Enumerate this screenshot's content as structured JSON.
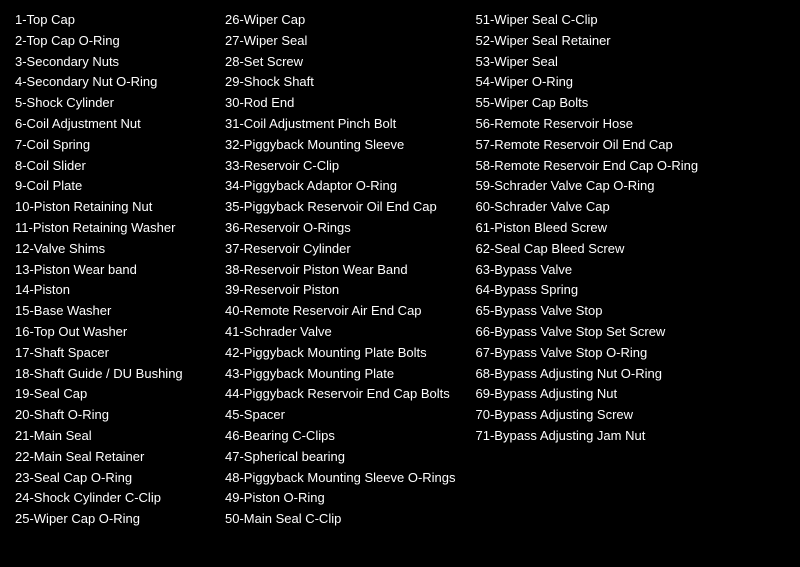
{
  "columns": [
    {
      "items": [
        "1-Top Cap",
        "2-Top Cap O-Ring",
        "3-Secondary Nuts",
        "4-Secondary Nut O-Ring",
        "5-Shock Cylinder",
        "6-Coil Adjustment Nut",
        "7-Coil Spring",
        "8-Coil Slider",
        "9-Coil Plate",
        "10-Piston Retaining Nut",
        "11-Piston Retaining Washer",
        "12-Valve Shims",
        "13-Piston Wear band",
        "14-Piston",
        "15-Base Washer",
        "16-Top Out Washer",
        "17-Shaft Spacer",
        "18-Shaft Guide / DU Bushing",
        "19-Seal Cap",
        "20-Shaft O-Ring",
        "21-Main Seal",
        "22-Main Seal Retainer",
        "23-Seal Cap O-Ring",
        "24-Shock Cylinder C-Clip",
        "25-Wiper Cap O-Ring"
      ]
    },
    {
      "items": [
        "26-Wiper Cap",
        "27-Wiper Seal",
        "28-Set Screw",
        "29-Shock Shaft",
        "30-Rod End",
        "31-Coil Adjustment Pinch Bolt",
        "32-Piggyback Mounting Sleeve",
        "33-Reservoir C-Clip",
        "34-Piggyback Adaptor O-Ring",
        "35-Piggyback Reservoir Oil End Cap",
        "36-Reservoir O-Rings",
        "37-Reservoir Cylinder",
        "38-Reservoir Piston Wear Band",
        "39-Reservoir Piston",
        "40-Remote Reservoir Air End Cap",
        "41-Schrader Valve",
        "42-Piggyback Mounting Plate Bolts",
        "43-Piggyback Mounting Plate",
        "44-Piggyback Reservoir End Cap Bolts",
        "45-Spacer",
        "46-Bearing C-Clips",
        "47-Spherical bearing",
        "48-Piggyback Mounting Sleeve O-Rings",
        "49-Piston O-Ring",
        "50-Main Seal C-Clip"
      ]
    },
    {
      "items": [
        "51-Wiper Seal C-Clip",
        "52-Wiper Seal Retainer",
        "53-Wiper Seal",
        "54-Wiper O-Ring",
        "55-Wiper Cap Bolts",
        "56-Remote Reservoir Hose",
        "57-Remote Reservoir Oil End Cap",
        "58-Remote Reservoir End Cap O-Ring",
        "59-Schrader Valve Cap O-Ring",
        "60-Schrader Valve Cap",
        "61-Piston Bleed Screw",
        "62-Seal Cap Bleed Screw",
        "63-Bypass Valve",
        "64-Bypass Spring",
        "65-Bypass Valve Stop",
        "66-Bypass Valve Stop Set Screw",
        "67-Bypass Valve Stop O-Ring",
        "68-Bypass Adjusting Nut O-Ring",
        "69-Bypass Adjusting Nut",
        "70-Bypass Adjusting Screw",
        "71-Bypass Adjusting Jam Nut"
      ]
    }
  ]
}
